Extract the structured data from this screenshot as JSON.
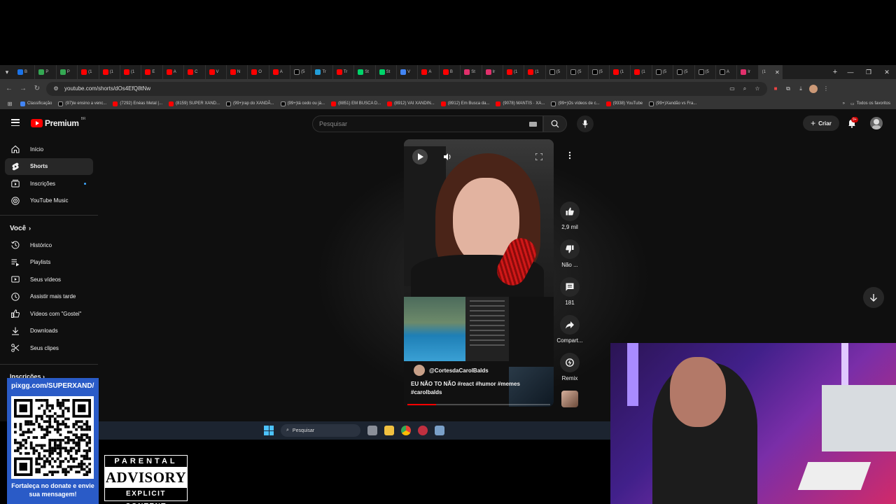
{
  "browser": {
    "url": "youtube.com/shorts/dOs4EfQ8tNw",
    "tab_count": 35,
    "active_tab_label": "(1",
    "tab_favicon_colors": [
      "#1a73e8",
      "#34a853",
      "#34a853",
      "#ff0000",
      "#ff0000",
      "#ff0000",
      "#ff0000",
      "#ff0000",
      "#ff0000",
      "#ff0000",
      "#ff0000",
      "#ff0000",
      "#ff0000",
      "#000000",
      "#229ed9",
      "#ff0000",
      "#00d46a",
      "#00d46a",
      "#4285f4",
      "#ff0000",
      "#ff0000",
      "#e1306c",
      "#e1306c",
      "#ff0000",
      "#ff0000",
      "#000000",
      "#000000",
      "#000000",
      "#ff0000",
      "#ff0000",
      "#000000",
      "#000000",
      "#000000",
      "#000000",
      "#e1306c"
    ],
    "tab_labels": [
      "B",
      "P",
      "P",
      "(1",
      "(1",
      "(1",
      "E",
      "A",
      "C",
      "V",
      "N",
      "O",
      "A",
      "(5",
      "Tr",
      "Tr",
      "St",
      "St",
      "V",
      "A",
      "B",
      "St",
      "Ir",
      "(1",
      "(1",
      "(5",
      "(5",
      "(5",
      "(1",
      "(1",
      "(5",
      "(5",
      "(5",
      "A",
      "Ir"
    ],
    "bookmarks": [
      {
        "label": "Classificação",
        "color": "#4285f4"
      },
      {
        "label": "(97)le ensino a venc...",
        "color": "#000000"
      },
      {
        "label": "(7292) Enéas Metal |...",
        "color": "#ff0000"
      },
      {
        "label": "(8159) SUPER XAND...",
        "color": "#ff0000"
      },
      {
        "label": "(99+)rap do XANDÃ...",
        "color": "#000000"
      },
      {
        "label": "(99+)tá cedo ou já...",
        "color": "#000000"
      },
      {
        "label": "(8851) EM BUSCA D...",
        "color": "#ff0000"
      },
      {
        "label": "(8912) VAI XANDIN...",
        "color": "#ff0000"
      },
      {
        "label": "(8912) Em Busca da...",
        "color": "#ff0000"
      },
      {
        "label": "(9078) MANTIS · XA...",
        "color": "#ff0000"
      },
      {
        "label": "(99+)Os vídeos de c...",
        "color": "#000000"
      },
      {
        "label": "(9338) YouTube",
        "color": "#ff0000"
      },
      {
        "label": "(99+)Xandão vs Fra...",
        "color": "#000000"
      }
    ],
    "bookmarks_all": "Todos os favoritos"
  },
  "youtube": {
    "logo_text": "Premium",
    "logo_country": "BR",
    "search_placeholder": "Pesquisar",
    "create_label": "Criar",
    "notification_badge": "9+",
    "sidebar": {
      "top_items": [
        {
          "label": "Início",
          "icon": "home-icon"
        },
        {
          "label": "Shorts",
          "icon": "shorts-icon",
          "active": true
        },
        {
          "label": "Inscrições",
          "icon": "subscriptions-icon",
          "dot": true
        },
        {
          "label": "YouTube Music",
          "icon": "music-icon"
        }
      ],
      "you_heading": "Você",
      "you_items": [
        {
          "label": "Histórico",
          "icon": "history-icon"
        },
        {
          "label": "Playlists",
          "icon": "playlists-icon"
        },
        {
          "label": "Seus vídeos",
          "icon": "your-videos-icon"
        },
        {
          "label": "Assistir mais tarde",
          "icon": "watch-later-icon"
        },
        {
          "label": "Vídeos com \"Gostei\"",
          "icon": "liked-icon"
        },
        {
          "label": "Downloads",
          "icon": "download-icon"
        },
        {
          "label": "Seus clipes",
          "icon": "clips-icon"
        }
      ],
      "subscriptions_heading": "Inscrições"
    },
    "short": {
      "channel": "@CortesdaCarolBalds",
      "caption": "EU NÃO TO NÃO #react #humor #memes #carolbalds",
      "progress": 0.2
    },
    "actions": {
      "likes": "2,9 mil",
      "dislike": "Não ...",
      "comments": "181",
      "share": "Compart...",
      "remix": "Remix"
    }
  },
  "taskbar": {
    "search_label": "Pesquisar"
  },
  "overlays": {
    "donate_url": "pixgg.com/SUPERXAND/",
    "donate_message": "Fortaleça no donate e envie sua mensagem!",
    "advisory_top": "PARENTAL",
    "advisory_mid": "ADVISORY",
    "advisory_bottom": "EXPLICIT CONTENT"
  }
}
